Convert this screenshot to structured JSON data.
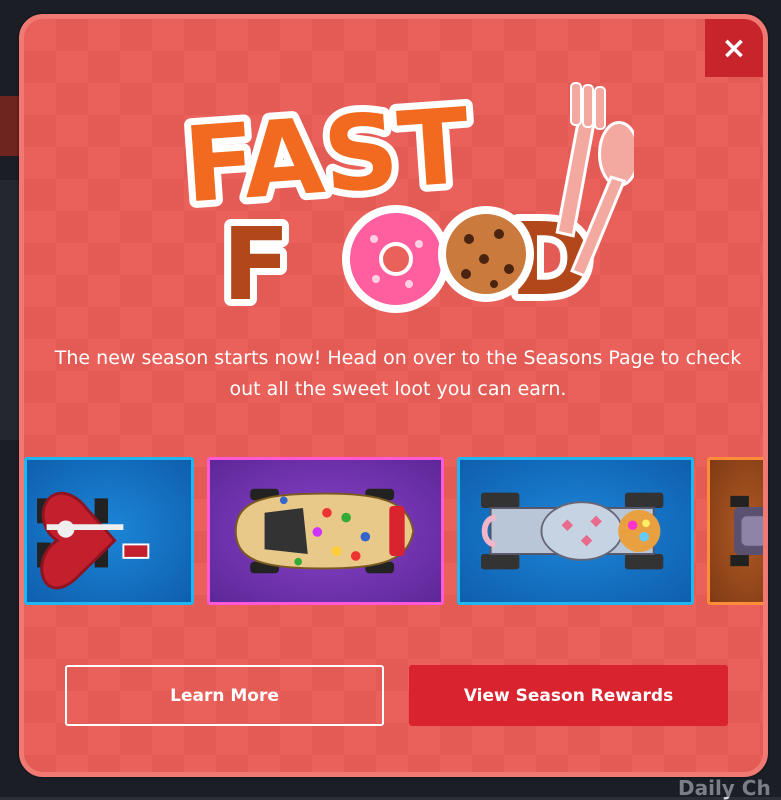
{
  "modal": {
    "close_label": "×",
    "logo": {
      "word1": "FAST",
      "word2_a": "F",
      "word2_b": "D",
      "colors": {
        "orange": "#f26a1f",
        "brown": "#a83f14",
        "donut": "#ff5f9e",
        "cookie": "#c97a3c"
      }
    },
    "description": "The new season starts now! Head on over to the Seasons Page to check out all the sweet loot you can earn.",
    "rewards": [
      {
        "name": "Chocolates heart car",
        "theme": "blue"
      },
      {
        "name": "Candy sports car",
        "theme": "purple"
      },
      {
        "name": "Easter egg car",
        "theme": "blue"
      },
      {
        "name": "Orange car (partial)",
        "theme": "orange"
      }
    ],
    "learn_more_label": "Learn More",
    "view_rewards_label": "View Season Rewards",
    "colors": {
      "background": "#e9615a",
      "accent": "#d9232e",
      "card_blue": "#20b6f0",
      "card_purple": "#ff58d6"
    }
  },
  "background": {
    "visible_text": "Daily Ch"
  }
}
